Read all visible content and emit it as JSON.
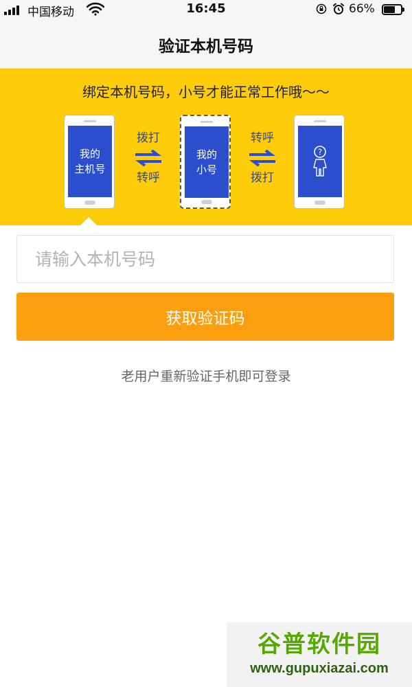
{
  "status_bar": {
    "carrier": "中国移动",
    "time": "16:45",
    "battery_percent": "66%",
    "battery_level": 0.66,
    "icons": [
      "signal-icon",
      "wifi-icon",
      "rotation-lock-icon",
      "alarm-icon",
      "battery-icon"
    ]
  },
  "nav": {
    "title": "验证本机号码"
  },
  "banner": {
    "headline": "绑定本机号码，小号才能正常工作哦～～",
    "phone_main_line1": "我的",
    "phone_main_line2": "主机号",
    "arrows_left_top": "拨打",
    "arrows_left_bottom": "转呼",
    "phone_small_line1": "我的",
    "phone_small_line2": "小号",
    "arrows_right_top": "转呼",
    "arrows_right_bottom": "拨打",
    "phone_unknown_icon": "unknown-person-icon",
    "background_color": "#ffcc0a",
    "screen_color": "#2b4ecf",
    "arrow_color": "#2b4ecf"
  },
  "form": {
    "phone_placeholder": "请输入本机号码",
    "phone_value": "",
    "get_code_label": "获取验证码",
    "button_color": "#fb9f0e",
    "hint": "老用户重新验证手机即可登录"
  },
  "watermark": {
    "title": "谷普软件园",
    "url": "www.gupuxiazai.com"
  }
}
